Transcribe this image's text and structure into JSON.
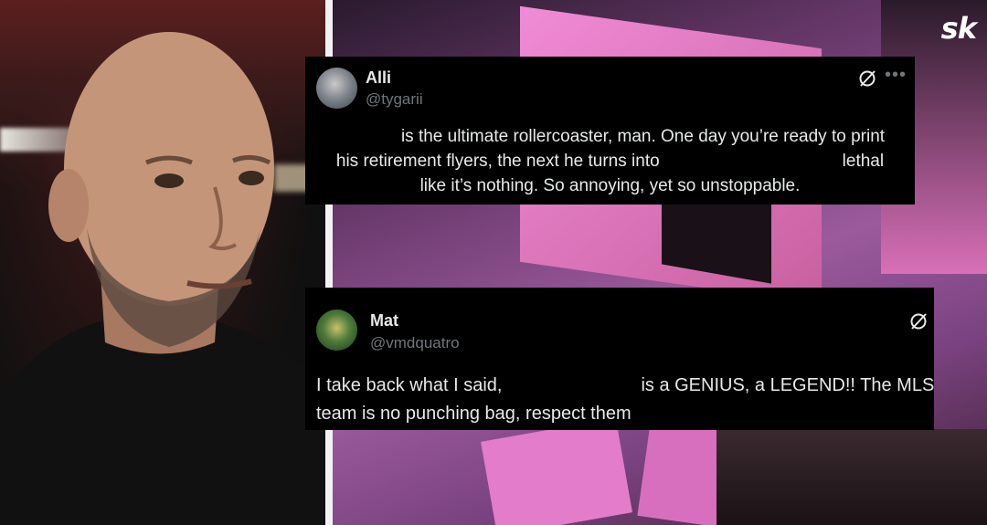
{
  "logo": {
    "text": "sk"
  },
  "tweets": [
    {
      "name": "Alli",
      "handle": "@tygarii",
      "lines": [
        "is the ultimate rollercoaster, man. One day you’re ready to print",
        "his retirement flyers, the next he turns into",
        "lethal",
        "like it’s nothing. So annoying, yet so unstoppable."
      ],
      "icons": [
        "grok-icon",
        "more-icon"
      ]
    },
    {
      "name": "Mat",
      "handle": "@vmdquatro",
      "lines": [
        "I take back what I said,",
        "is a GENIUS, a LEGEND!! The MLS",
        "team is no punching bag, respect them"
      ],
      "icons": [
        "grok-icon"
      ]
    }
  ],
  "colors": {
    "card_bg": "#000000",
    "text_primary": "#e7e9ea",
    "text_secondary": "#71767b",
    "flag_pink": "#e07cc8"
  }
}
